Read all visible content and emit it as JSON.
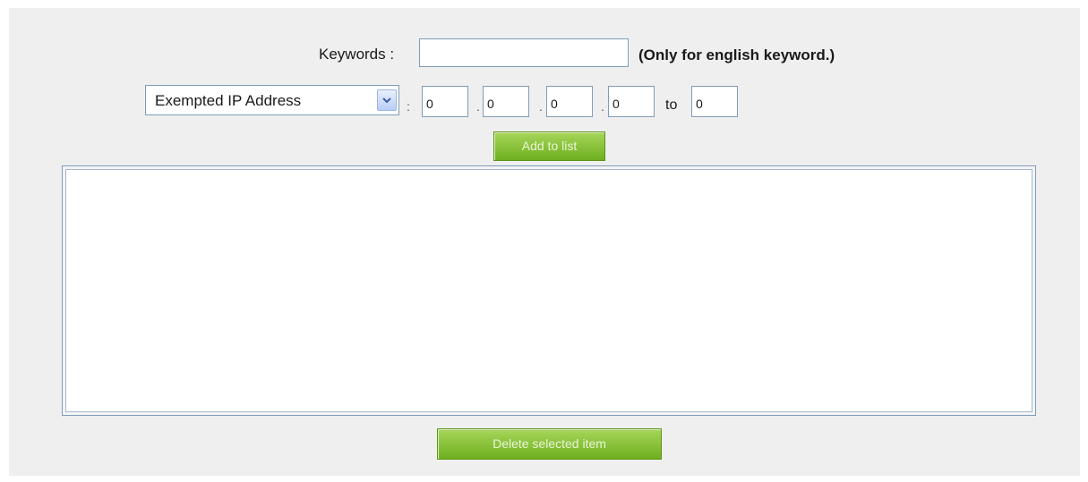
{
  "keywords": {
    "label": "Keywords :",
    "value": "",
    "note": "(Only for english keyword.)"
  },
  "ip_filter": {
    "type_selected": "Exempted IP Address",
    "separator": ":",
    "octet_sep": ".",
    "octets": [
      "0",
      "0",
      "0",
      "0"
    ],
    "to_label": "to",
    "to_value": "0"
  },
  "actions": {
    "add_label": "Add to list",
    "delete_label": "Delete selected item"
  },
  "list": {
    "items": []
  },
  "icons": {
    "select_arrow": "chevron-down-icon"
  },
  "colors": {
    "button_green": "#8cc43d",
    "panel_bg": "#efefef",
    "input_border": "#7f9db9"
  }
}
